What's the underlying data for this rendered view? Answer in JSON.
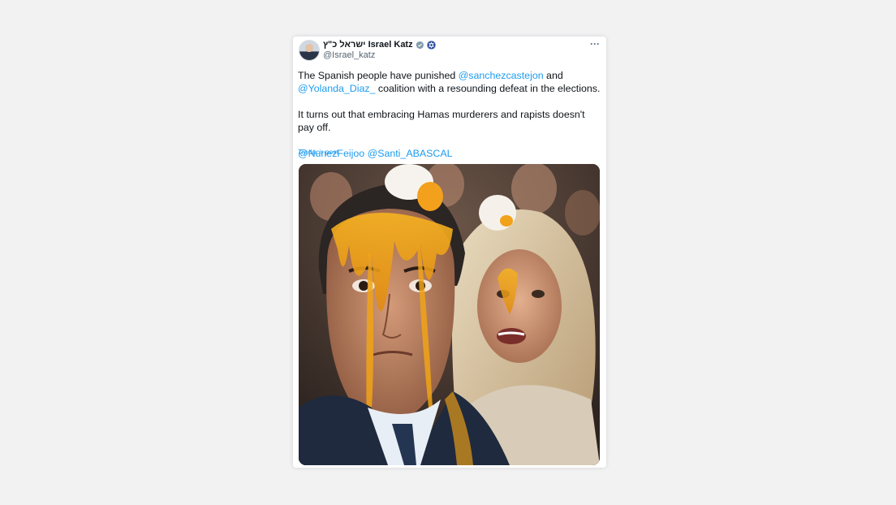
{
  "tweet": {
    "author": {
      "display_name": "ישראל כ\"ץ Israel Katz",
      "handle": "@Israel_katz",
      "verified_icon": "verified-badge-icon",
      "flag_icon": "israel-flag-emoji-icon"
    },
    "more_label": "···",
    "text_line1_prefix": "The Spanish people have punished ",
    "mention_1": "@sanchezcastejon",
    "text_line1_suffix": " and",
    "mention_2": "@Yolanda_Diaz_",
    "text_line2_suffix": " coalition with a resounding defeat in the elections.",
    "paragraph_2": "It turns out that embracing Hamas murderers and rapists doesn't pay off.",
    "mention_3": "@NunezFeijoo",
    "mention_4": "@Santi_ABASCAL",
    "translate_label": "Traducir post",
    "media": "image: two people with egg yolk dripping down their faces in a crowd"
  },
  "colors": {
    "link": "#1d9bf0",
    "text": "#0f1419",
    "secondary": "#536471",
    "background": "#f2f2f3"
  }
}
